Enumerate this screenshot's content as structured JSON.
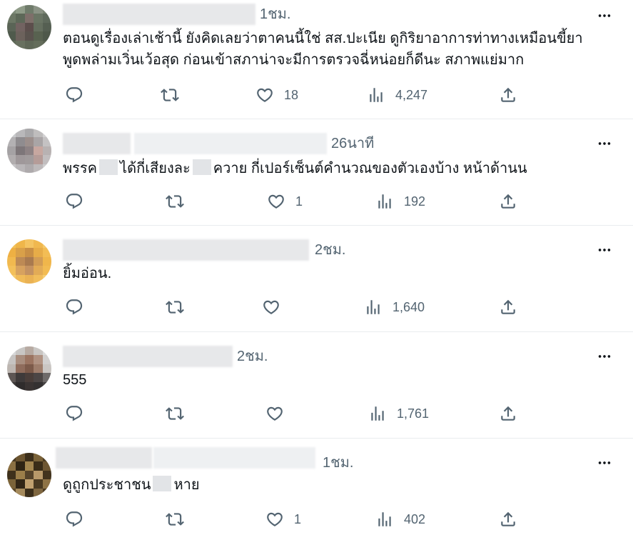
{
  "posts": [
    {
      "time": "1ชม.",
      "text_lines": [
        "ตอนดูเรื่องเล่าเช้านี้ ยังคิดเลยว่าตาคนนี้ใช่ สส.ปะเนีย ดูกิริยาอาการท่าทางเหมือนขี้ยา",
        "พูดพล่ามเวิ่นเว้อสุด ก่อนเข้าสภาน่าจะมีการตรวจฉี่หน่อยก็ดีนะ สภาพแย่มาก"
      ],
      "likes": "18",
      "views": "4,247"
    },
    {
      "time": "26นาที",
      "text_parts": [
        "พรรค",
        "ได้กี่เสียงละ",
        "ควาย กี่เปอร์เซ็นต์คำนวณของตัวเองบ้าง หน้าด้านน"
      ],
      "likes": "1",
      "views": "192"
    },
    {
      "time": "2ชม.",
      "text": "ยิ้มอ่อน.",
      "likes": "",
      "views": "1,640"
    },
    {
      "time": "2ชม.",
      "text": "555",
      "likes": "",
      "views": "1,761"
    },
    {
      "time": "1ชม.",
      "text_parts": [
        "ดูถูกประชาชน",
        "หาย"
      ],
      "likes": "1",
      "views": "402"
    }
  ],
  "icons": {
    "reply": "reply-icon",
    "repost": "repost-icon",
    "like": "heart-icon",
    "views": "views-icon",
    "share": "share-icon",
    "more": "more-options-icon"
  },
  "colors": {
    "text": "#0f1419",
    "secondary": "#536471",
    "divider": "#e9ecef"
  }
}
